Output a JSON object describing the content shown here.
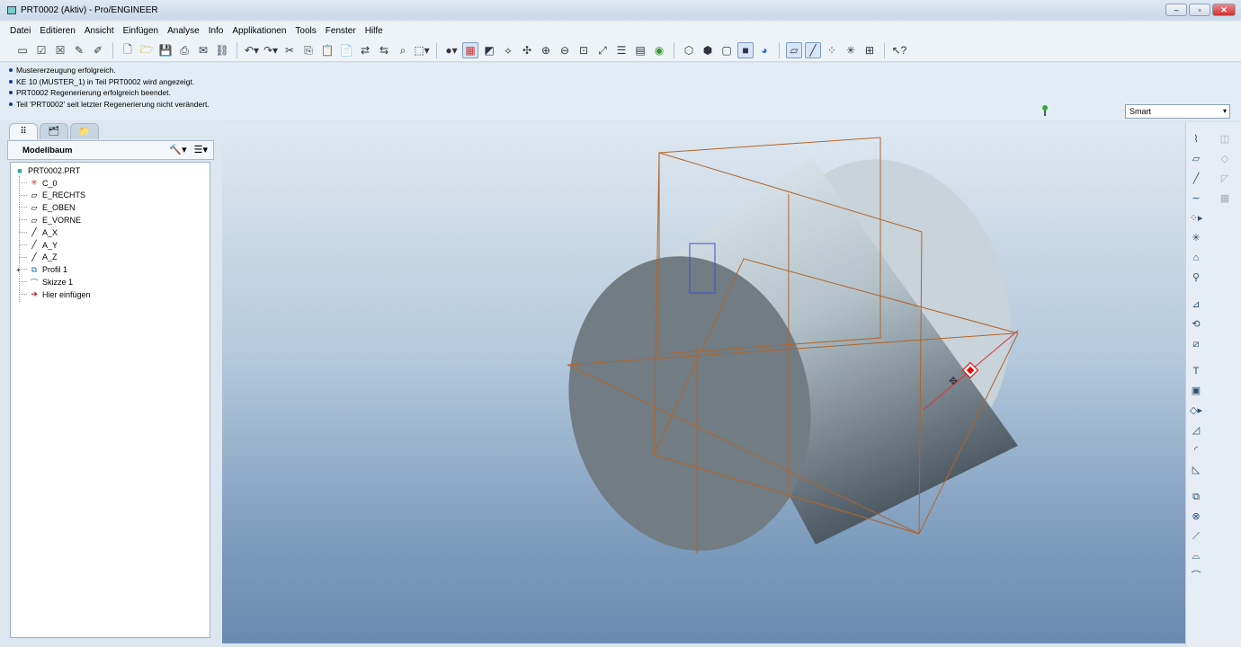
{
  "window": {
    "title": "PRT0002 (Aktiv) - Pro/ENGINEER",
    "minimize": "‒",
    "maximize": "▫",
    "close": "✕"
  },
  "menu": [
    "Datei",
    "Editieren",
    "Ansicht",
    "Einfügen",
    "Analyse",
    "Info",
    "Applikationen",
    "Tools",
    "Fenster",
    "Hilfe"
  ],
  "messages": [
    "Mustererzeugung erfolgreich.",
    "KE 10 (MUSTER_1) in Teil PRT0002 wird angezeigt.",
    "PRT0002 Regenerierung erfolgreich beendet.",
    "Teil 'PRT0002' seit letzter Regenerierung nicht verändert."
  ],
  "filter": {
    "selected": "Smart"
  },
  "model_tree": {
    "title": "Modellbaum",
    "root": "PRT0002.PRT",
    "items": [
      {
        "label": "C_0",
        "icon": "coordinate-system-icon"
      },
      {
        "label": "E_RECHTS",
        "icon": "datum-plane-icon"
      },
      {
        "label": "E_OBEN",
        "icon": "datum-plane-icon"
      },
      {
        "label": "E_VORNE",
        "icon": "datum-plane-icon"
      },
      {
        "label": "A_X",
        "icon": "datum-axis-icon"
      },
      {
        "label": "A_Y",
        "icon": "datum-axis-icon"
      },
      {
        "label": "A_Z",
        "icon": "datum-axis-icon"
      },
      {
        "label": "Profil 1",
        "icon": "extrude-icon"
      },
      {
        "label": "Skizze 1",
        "icon": "sketch-icon"
      },
      {
        "label": "Hier einfügen",
        "icon": "insert-here-arrow-icon"
      }
    ]
  },
  "colors": {
    "accent": "#123c9a",
    "datum": "#b0642c",
    "viewport_top": "#dfe8f1",
    "viewport_bottom": "#6a8ab0"
  }
}
